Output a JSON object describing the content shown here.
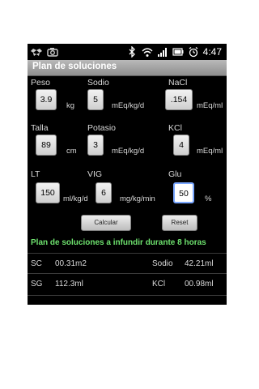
{
  "status_bar": {
    "time": "4:47",
    "icons": [
      "dropbox-icon",
      "camera-icon",
      "bluetooth-icon",
      "wifi-icon",
      "signal-icon",
      "battery-icon",
      "alarm-icon"
    ]
  },
  "title": "Plan de soluciones",
  "fields": {
    "peso": {
      "label": "Peso",
      "value": "3.9",
      "unit": "kg"
    },
    "sodio": {
      "label": "Sodio",
      "value": "5",
      "unit": "mEq/kg/d"
    },
    "nacl": {
      "label": "NaCl",
      "value": ".154",
      "unit": "mEq/ml"
    },
    "talla": {
      "label": "Talla",
      "value": "89",
      "unit": "cm"
    },
    "potasio": {
      "label": "Potasio",
      "value": "3",
      "unit": "mEq/kg/d"
    },
    "kcl": {
      "label": "KCl",
      "value": "4",
      "unit": "mEq/ml"
    },
    "lt": {
      "label": "LT",
      "value": "150",
      "unit": "ml/kg/d"
    },
    "vig": {
      "label": "VIG",
      "value": "6",
      "unit": "mg/kg/min"
    },
    "glu": {
      "label": "Glu",
      "value": "50",
      "unit": "%"
    }
  },
  "buttons": {
    "calcular": "Calcular",
    "reset": "Reset"
  },
  "results_title": "Plan de soluciones a infundir durante 8 horas",
  "results": {
    "sc": {
      "label": "SC",
      "value": "00.31m2"
    },
    "sodio": {
      "label": "Sodio",
      "value": "42.21ml"
    },
    "sg": {
      "label": "SG",
      "value": "112.3ml"
    },
    "kcl": {
      "label": "KCl",
      "value": "00.98ml"
    }
  },
  "colors": {
    "accent_green": "#6ee26e",
    "focus_blue": "#7aa7ff"
  }
}
